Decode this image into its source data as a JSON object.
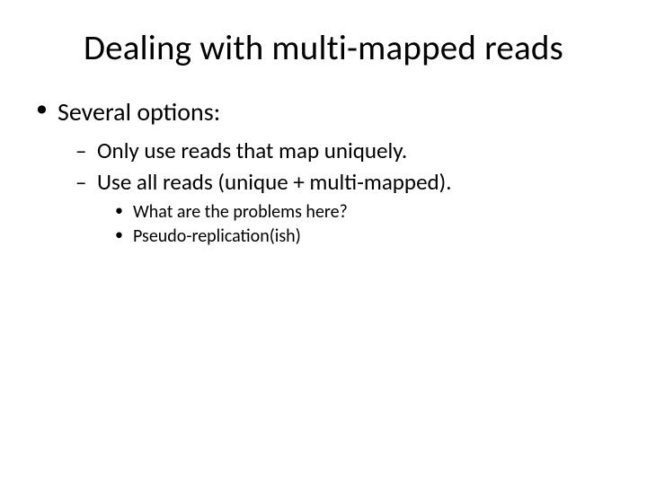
{
  "title": "Dealing with multi-mapped reads",
  "bullets": {
    "l1_0": "Several options:",
    "l2_0": "Only use reads that map uniquely.",
    "l2_1": "Use all reads (unique + multi-mapped).",
    "l3_0": "What are the problems here?",
    "l3_1": "Pseudo-replication(ish)"
  }
}
